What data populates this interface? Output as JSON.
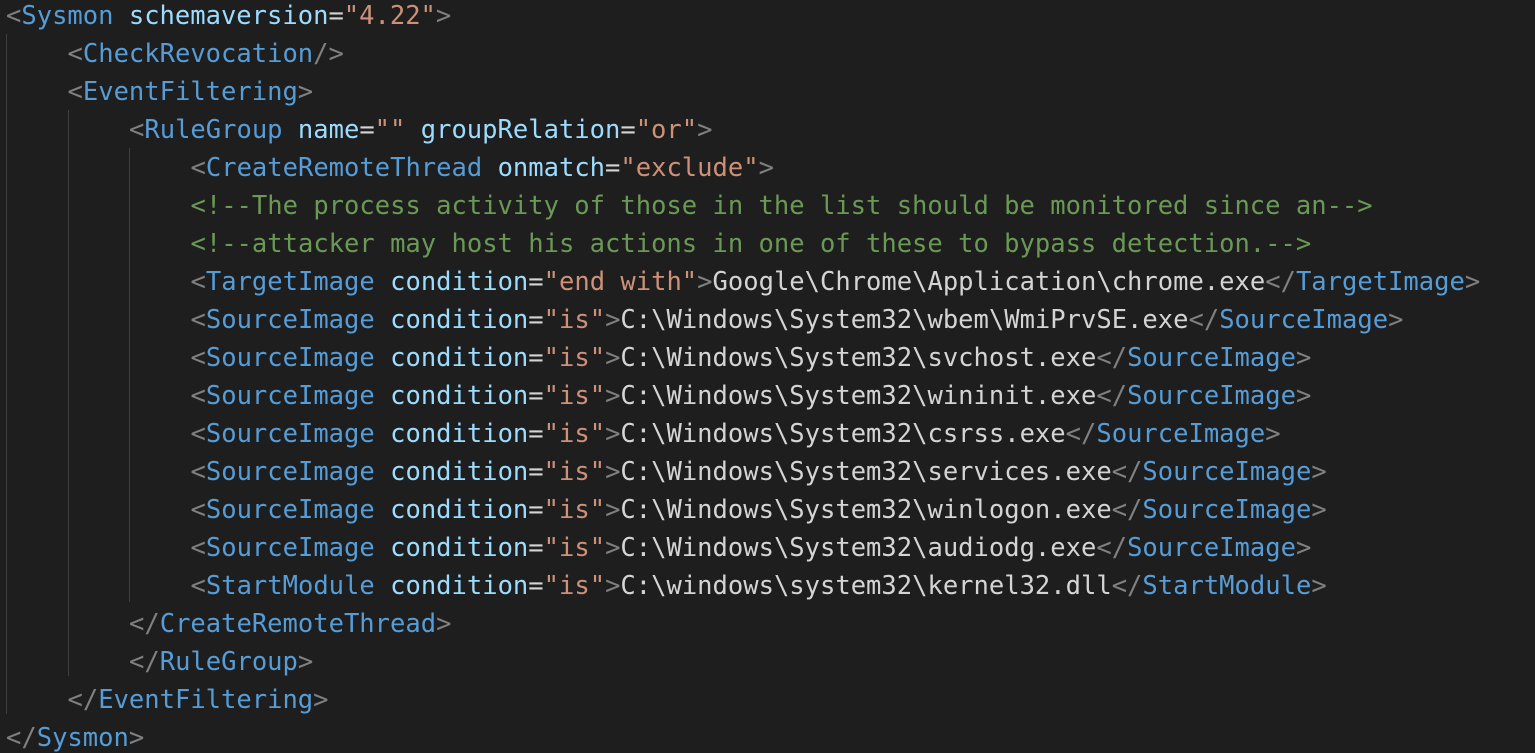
{
  "editor": {
    "colors": {
      "background": "#1e1e1e",
      "punctuation": "#808080",
      "tag": "#569cd6",
      "attribute": "#9cdcfe",
      "string": "#ce9178",
      "text": "#d4d4d4",
      "comment": "#6a9955",
      "indent_guide": "#404040"
    },
    "lines": [
      {
        "indent": 0,
        "tokens": [
          {
            "k": "pu",
            "t": "<"
          },
          {
            "k": "tg",
            "t": "Sysmon"
          },
          {
            "k": "tx",
            "t": " "
          },
          {
            "k": "at",
            "t": "schemaversion"
          },
          {
            "k": "eq",
            "t": "="
          },
          {
            "k": "st",
            "t": "\"4.22\""
          },
          {
            "k": "pu",
            "t": ">"
          }
        ]
      },
      {
        "indent": 1,
        "tokens": [
          {
            "k": "pu",
            "t": "<"
          },
          {
            "k": "tg",
            "t": "CheckRevocation"
          },
          {
            "k": "pu",
            "t": "/>"
          }
        ]
      },
      {
        "indent": 1,
        "tokens": [
          {
            "k": "pu",
            "t": "<"
          },
          {
            "k": "tg",
            "t": "EventFiltering"
          },
          {
            "k": "pu",
            "t": ">"
          }
        ]
      },
      {
        "indent": 2,
        "tokens": [
          {
            "k": "pu",
            "t": "<"
          },
          {
            "k": "tg",
            "t": "RuleGroup"
          },
          {
            "k": "tx",
            "t": " "
          },
          {
            "k": "at",
            "t": "name"
          },
          {
            "k": "eq",
            "t": "="
          },
          {
            "k": "st",
            "t": "\"\""
          },
          {
            "k": "tx",
            "t": " "
          },
          {
            "k": "at",
            "t": "groupRelation"
          },
          {
            "k": "eq",
            "t": "="
          },
          {
            "k": "st",
            "t": "\"or\""
          },
          {
            "k": "pu",
            "t": ">"
          }
        ]
      },
      {
        "indent": 3,
        "tokens": [
          {
            "k": "pu",
            "t": "<"
          },
          {
            "k": "tg",
            "t": "CreateRemoteThread"
          },
          {
            "k": "tx",
            "t": " "
          },
          {
            "k": "at",
            "t": "onmatch"
          },
          {
            "k": "eq",
            "t": "="
          },
          {
            "k": "st",
            "t": "\"exclude\""
          },
          {
            "k": "pu",
            "t": ">"
          }
        ]
      },
      {
        "indent": 3,
        "tokens": [
          {
            "k": "cm",
            "t": "<!--The process activity of those in the list should be monitored since an-->"
          }
        ]
      },
      {
        "indent": 3,
        "tokens": [
          {
            "k": "cm",
            "t": "<!--attacker may host his actions in one of these to bypass detection.-->"
          }
        ]
      },
      {
        "indent": 3,
        "tokens": [
          {
            "k": "pu",
            "t": "<"
          },
          {
            "k": "tg",
            "t": "TargetImage"
          },
          {
            "k": "tx",
            "t": " "
          },
          {
            "k": "at",
            "t": "condition"
          },
          {
            "k": "eq",
            "t": "="
          },
          {
            "k": "st",
            "t": "\"end with\""
          },
          {
            "k": "pu",
            "t": ">"
          },
          {
            "k": "tx",
            "t": "Google\\Chrome\\Application\\chrome.exe"
          },
          {
            "k": "pu",
            "t": "</"
          },
          {
            "k": "tg",
            "t": "TargetImage"
          },
          {
            "k": "pu",
            "t": ">"
          }
        ]
      },
      {
        "indent": 3,
        "tokens": [
          {
            "k": "pu",
            "t": "<"
          },
          {
            "k": "tg",
            "t": "SourceImage"
          },
          {
            "k": "tx",
            "t": " "
          },
          {
            "k": "at",
            "t": "condition"
          },
          {
            "k": "eq",
            "t": "="
          },
          {
            "k": "st",
            "t": "\"is\""
          },
          {
            "k": "pu",
            "t": ">"
          },
          {
            "k": "tx",
            "t": "C:\\Windows\\System32\\wbem\\WmiPrvSE.exe"
          },
          {
            "k": "pu",
            "t": "</"
          },
          {
            "k": "tg",
            "t": "SourceImage"
          },
          {
            "k": "pu",
            "t": ">"
          }
        ]
      },
      {
        "indent": 3,
        "tokens": [
          {
            "k": "pu",
            "t": "<"
          },
          {
            "k": "tg",
            "t": "SourceImage"
          },
          {
            "k": "tx",
            "t": " "
          },
          {
            "k": "at",
            "t": "condition"
          },
          {
            "k": "eq",
            "t": "="
          },
          {
            "k": "st",
            "t": "\"is\""
          },
          {
            "k": "pu",
            "t": ">"
          },
          {
            "k": "tx",
            "t": "C:\\Windows\\System32\\svchost.exe"
          },
          {
            "k": "pu",
            "t": "</"
          },
          {
            "k": "tg",
            "t": "SourceImage"
          },
          {
            "k": "pu",
            "t": ">"
          }
        ]
      },
      {
        "indent": 3,
        "tokens": [
          {
            "k": "pu",
            "t": "<"
          },
          {
            "k": "tg",
            "t": "SourceImage"
          },
          {
            "k": "tx",
            "t": " "
          },
          {
            "k": "at",
            "t": "condition"
          },
          {
            "k": "eq",
            "t": "="
          },
          {
            "k": "st",
            "t": "\"is\""
          },
          {
            "k": "pu",
            "t": ">"
          },
          {
            "k": "tx",
            "t": "C:\\Windows\\System32\\wininit.exe"
          },
          {
            "k": "pu",
            "t": "</"
          },
          {
            "k": "tg",
            "t": "SourceImage"
          },
          {
            "k": "pu",
            "t": ">"
          }
        ]
      },
      {
        "indent": 3,
        "tokens": [
          {
            "k": "pu",
            "t": "<"
          },
          {
            "k": "tg",
            "t": "SourceImage"
          },
          {
            "k": "tx",
            "t": " "
          },
          {
            "k": "at",
            "t": "condition"
          },
          {
            "k": "eq",
            "t": "="
          },
          {
            "k": "st",
            "t": "\"is\""
          },
          {
            "k": "pu",
            "t": ">"
          },
          {
            "k": "tx",
            "t": "C:\\Windows\\System32\\csrss.exe"
          },
          {
            "k": "pu",
            "t": "</"
          },
          {
            "k": "tg",
            "t": "SourceImage"
          },
          {
            "k": "pu",
            "t": ">"
          }
        ]
      },
      {
        "indent": 3,
        "tokens": [
          {
            "k": "pu",
            "t": "<"
          },
          {
            "k": "tg",
            "t": "SourceImage"
          },
          {
            "k": "tx",
            "t": " "
          },
          {
            "k": "at",
            "t": "condition"
          },
          {
            "k": "eq",
            "t": "="
          },
          {
            "k": "st",
            "t": "\"is\""
          },
          {
            "k": "pu",
            "t": ">"
          },
          {
            "k": "tx",
            "t": "C:\\Windows\\System32\\services.exe"
          },
          {
            "k": "pu",
            "t": "</"
          },
          {
            "k": "tg",
            "t": "SourceImage"
          },
          {
            "k": "pu",
            "t": ">"
          }
        ]
      },
      {
        "indent": 3,
        "tokens": [
          {
            "k": "pu",
            "t": "<"
          },
          {
            "k": "tg",
            "t": "SourceImage"
          },
          {
            "k": "tx",
            "t": " "
          },
          {
            "k": "at",
            "t": "condition"
          },
          {
            "k": "eq",
            "t": "="
          },
          {
            "k": "st",
            "t": "\"is\""
          },
          {
            "k": "pu",
            "t": ">"
          },
          {
            "k": "tx",
            "t": "C:\\Windows\\System32\\winlogon.exe"
          },
          {
            "k": "pu",
            "t": "</"
          },
          {
            "k": "tg",
            "t": "SourceImage"
          },
          {
            "k": "pu",
            "t": ">"
          }
        ]
      },
      {
        "indent": 3,
        "tokens": [
          {
            "k": "pu",
            "t": "<"
          },
          {
            "k": "tg",
            "t": "SourceImage"
          },
          {
            "k": "tx",
            "t": " "
          },
          {
            "k": "at",
            "t": "condition"
          },
          {
            "k": "eq",
            "t": "="
          },
          {
            "k": "st",
            "t": "\"is\""
          },
          {
            "k": "pu",
            "t": ">"
          },
          {
            "k": "tx",
            "t": "C:\\Windows\\System32\\audiodg.exe"
          },
          {
            "k": "pu",
            "t": "</"
          },
          {
            "k": "tg",
            "t": "SourceImage"
          },
          {
            "k": "pu",
            "t": ">"
          }
        ]
      },
      {
        "indent": 3,
        "tokens": [
          {
            "k": "pu",
            "t": "<"
          },
          {
            "k": "tg",
            "t": "StartModule"
          },
          {
            "k": "tx",
            "t": " "
          },
          {
            "k": "at",
            "t": "condition"
          },
          {
            "k": "eq",
            "t": "="
          },
          {
            "k": "st",
            "t": "\"is\""
          },
          {
            "k": "pu",
            "t": ">"
          },
          {
            "k": "tx",
            "t": "C:\\windows\\system32\\kernel32.dll"
          },
          {
            "k": "pu",
            "t": "</"
          },
          {
            "k": "tg",
            "t": "StartModule"
          },
          {
            "k": "pu",
            "t": ">"
          }
        ]
      },
      {
        "indent": 2,
        "tokens": [
          {
            "k": "pu",
            "t": "</"
          },
          {
            "k": "tg",
            "t": "CreateRemoteThread"
          },
          {
            "k": "pu",
            "t": ">"
          }
        ]
      },
      {
        "indent": 2,
        "tokens": [
          {
            "k": "pu",
            "t": "</"
          },
          {
            "k": "tg",
            "t": "RuleGroup"
          },
          {
            "k": "pu",
            "t": ">"
          }
        ]
      },
      {
        "indent": 1,
        "tokens": [
          {
            "k": "pu",
            "t": "</"
          },
          {
            "k": "tg",
            "t": "EventFiltering"
          },
          {
            "k": "pu",
            "t": ">"
          }
        ]
      },
      {
        "indent": 0,
        "tokens": [
          {
            "k": "pu",
            "t": "</"
          },
          {
            "k": "tg",
            "t": "Sysmon"
          },
          {
            "k": "pu",
            "t": ">"
          }
        ]
      }
    ]
  }
}
